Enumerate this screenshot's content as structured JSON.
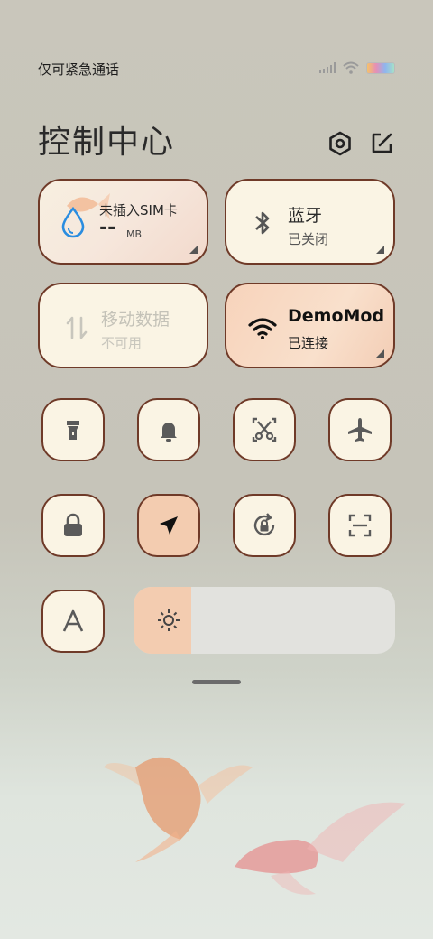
{
  "status_bar": {
    "carrier": "仅可紧急通话"
  },
  "header": {
    "title": "控制中心",
    "settings_icon": "hexagon-settings-icon",
    "edit_icon": "edit-icon"
  },
  "tiles": {
    "sim": {
      "title": "未插入SIM卡",
      "value": "--",
      "unit": "MB",
      "icon": "water-drop-icon"
    },
    "bluetooth": {
      "title": "蓝牙",
      "status": "已关闭",
      "icon": "bluetooth-icon"
    },
    "mobile_data": {
      "title": "移动数据",
      "status": "不可用",
      "icon": "data-arrows-icon"
    },
    "wifi": {
      "title": "DemoMod",
      "status": "已连接",
      "icon": "wifi-icon"
    }
  },
  "toggles": [
    {
      "name": "flashlight",
      "icon": "flashlight-icon",
      "active": false
    },
    {
      "name": "bell",
      "icon": "bell-icon",
      "active": false
    },
    {
      "name": "screenshot",
      "icon": "scissors-screenshot-icon",
      "active": false
    },
    {
      "name": "airplane",
      "icon": "airplane-icon",
      "active": false
    },
    {
      "name": "lock",
      "icon": "lock-icon",
      "active": false
    },
    {
      "name": "location",
      "icon": "location-arrow-icon",
      "active": true
    },
    {
      "name": "rotation-lock",
      "icon": "rotation-lock-icon",
      "active": false
    },
    {
      "name": "scan",
      "icon": "scan-icon",
      "active": false
    },
    {
      "name": "reading-mode",
      "icon": "letter-a-icon",
      "active": false
    }
  ],
  "brightness": {
    "level": 0.22,
    "icon": "sun-icon"
  },
  "colors": {
    "border": "#6f3a28",
    "tile_bg": "#faf4e4",
    "active_bg": "#f3ccb0",
    "sim_blue": "#2a8de0"
  }
}
